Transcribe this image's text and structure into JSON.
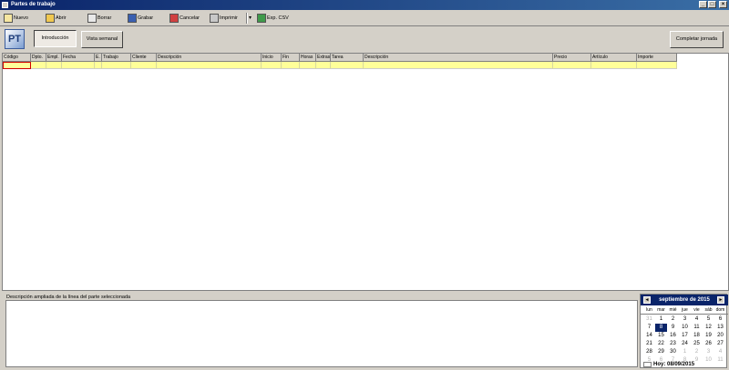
{
  "window": {
    "title": "Partes de trabajo"
  },
  "toolbar": {
    "buttons": [
      {
        "label": "Nuevo",
        "icon": "new-icon"
      },
      {
        "label": "Abrir",
        "icon": "open-icon"
      },
      {
        "label": "Borrar",
        "icon": "delete-icon"
      },
      {
        "label": "Grabar",
        "icon": "save-icon"
      },
      {
        "label": "Cancelar",
        "icon": "cancel-icon"
      },
      {
        "label": "Imprimir",
        "icon": "print-icon"
      },
      {
        "label": "Exp. CSV",
        "icon": "export-csv-icon"
      }
    ]
  },
  "secbar": {
    "logo": "PT",
    "tabs": [
      {
        "label": "Introducción",
        "active": true
      },
      {
        "label": "Vista semanal",
        "active": false
      }
    ],
    "complete_label": "Completar jornada"
  },
  "grid": {
    "columns": [
      "Código",
      "Dpto.",
      "Empl.",
      "Fecha",
      "E.",
      "Trabajo",
      "Cliente",
      "Descripción",
      "Inicio",
      "Fin",
      "Horas",
      "Extras",
      "Tarea",
      "Descripción",
      "Precio",
      "Artículo",
      "Importe"
    ]
  },
  "description": {
    "label": "Descripción ampliada de la línea del parte seleccionada"
  },
  "calendar": {
    "month": "septiembre de 2015",
    "weekdays": [
      "lun",
      "mar",
      "mié",
      "jue",
      "vie",
      "sáb",
      "dom"
    ],
    "days": [
      [
        "31",
        "1",
        "2",
        "3",
        "4",
        "5",
        "6"
      ],
      [
        "7",
        "8",
        "9",
        "10",
        "11",
        "12",
        "13"
      ],
      [
        "14",
        "15",
        "16",
        "17",
        "18",
        "19",
        "20"
      ],
      [
        "21",
        "22",
        "23",
        "24",
        "25",
        "26",
        "27"
      ],
      [
        "28",
        "29",
        "30",
        "1",
        "2",
        "3",
        "4"
      ],
      [
        "5",
        "6",
        "7",
        "8",
        "9",
        "10",
        "11"
      ]
    ],
    "selected": "8",
    "today": "Hoy: 08/09/2015"
  },
  "colors": {
    "titlebar": "#0a246a",
    "selected_row": "#ffff99",
    "face": "#d4d0c8"
  }
}
